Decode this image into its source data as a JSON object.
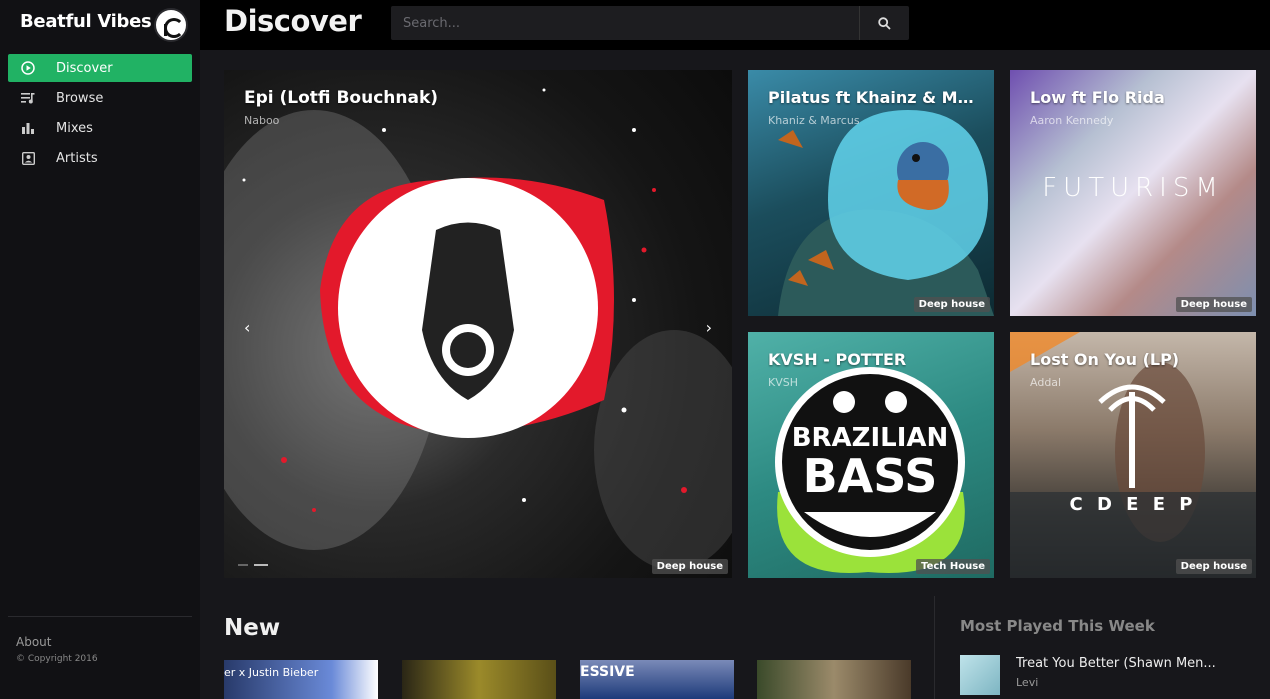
{
  "brand": {
    "name": "Beatful Vibes",
    "logo_icon": "headphone-p-logo"
  },
  "sidebar": {
    "items": [
      {
        "label": "Discover",
        "icon": "play-circle-icon",
        "active": true
      },
      {
        "label": "Browse",
        "icon": "playlist-icon",
        "active": false
      },
      {
        "label": "Mixes",
        "icon": "bar-chart-icon",
        "active": false
      },
      {
        "label": "Artists",
        "icon": "contact-card-icon",
        "active": false
      }
    ],
    "about": "About",
    "copyright": "© Copyright 2016"
  },
  "header": {
    "title": "Discover",
    "search_placeholder": "Search..."
  },
  "featured": {
    "title": "Epi (Lotfi Bouchnak)",
    "artist": "Naboo",
    "tag": "Deep house"
  },
  "cards": [
    {
      "title": "Pilatus ft Khainz & Mar...",
      "artist": "Khaniz & Marcus",
      "tag": "Deep house"
    },
    {
      "title": "Low ft Flo Rida",
      "artist": "Aaron Kennedy",
      "tag": "Deep house",
      "art_text": "FUTURISM"
    },
    {
      "title": "KVSH - POTTER",
      "artist": "KVSH",
      "tag": "Tech House",
      "art_text_1": "BRAZILIAN",
      "art_text_2": "BASS"
    },
    {
      "title": "Lost On You (LP)",
      "artist": "Addal",
      "tag": "Deep house",
      "art_text": "C  D  E  E  P"
    }
  ],
  "new_section": {
    "title": "New",
    "thumbs": [
      {
        "caption": "er x Justin Bieber"
      },
      {
        "caption": ""
      },
      {
        "caption": "ESSIVE"
      },
      {
        "caption": ""
      }
    ]
  },
  "most_played": {
    "title": "Most Played This Week",
    "items": [
      {
        "song": "Treat You Better (Shawn Men...",
        "artist": "Levi"
      }
    ]
  },
  "colors": {
    "accent": "#21b264",
    "topbar": "#000000",
    "sidebar": "#111114",
    "background": "#17171b"
  }
}
